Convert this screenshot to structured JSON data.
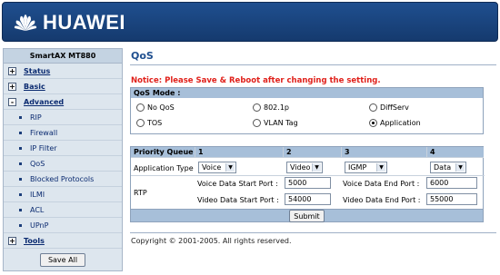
{
  "brand": {
    "name": "HUAWEI"
  },
  "sidebar": {
    "model": "SmartAX MT880",
    "items": [
      {
        "label": "Status",
        "box": "+"
      },
      {
        "label": "Basic",
        "box": "+"
      },
      {
        "label": "Advanced",
        "box": "-"
      }
    ],
    "sub_items": [
      "RIP",
      "Firewall",
      "IP Filter",
      "QoS",
      "Blocked Protocols",
      "ILMI",
      "ACL",
      "UPnP"
    ],
    "tools": {
      "label": "Tools",
      "box": "+"
    },
    "save_all": "Save All"
  },
  "page": {
    "title": "QoS",
    "notice": "Notice: Please Save & Reboot after changing the setting.",
    "copyright": "Copyright © 2001-2005. All rights reserved."
  },
  "qos_mode": {
    "heading": "QoS Mode :",
    "options": [
      "No QoS",
      "802.1p",
      "DiffServ",
      "TOS",
      "VLAN Tag",
      "Application"
    ],
    "selected": "Application"
  },
  "priority": {
    "header": [
      "Priority Queue",
      "1",
      "2",
      "3",
      "4"
    ],
    "app_type_label": "Application Type",
    "app_types": [
      "Voice",
      "Video",
      "IGMP",
      "Data"
    ],
    "rtp_label": "RTP",
    "voice_start_label": "Voice Data Start Port :",
    "voice_start": "5000",
    "voice_end_label": "Voice Data End Port :",
    "voice_end": "6000",
    "video_start_label": "Video Data Start Port :",
    "video_start": "54000",
    "video_end_label": "Video Data End Port :",
    "video_end": "55000",
    "submit": "Submit"
  }
}
